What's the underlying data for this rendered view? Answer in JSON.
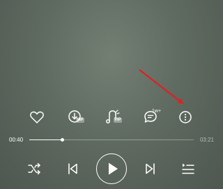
{
  "player": {
    "actions": {
      "like": {
        "icon": "heart-icon"
      },
      "download": {
        "icon": "download-icon",
        "badge": "VIP"
      },
      "ringtone": {
        "icon": "ringtone-icon",
        "badge": "VIP"
      },
      "comments": {
        "icon": "comment-icon",
        "count": "1w+"
      },
      "more": {
        "icon": "more-vertical-icon"
      }
    },
    "progress": {
      "current_time": "00:40",
      "total_time": "03:21",
      "fraction": 0.2
    },
    "controls": {
      "shuffle": {
        "icon": "shuffle-icon"
      },
      "previous": {
        "icon": "skip-previous-icon"
      },
      "play": {
        "icon": "play-icon"
      },
      "next": {
        "icon": "skip-next-icon"
      },
      "playlist": {
        "icon": "playlist-icon"
      }
    }
  },
  "annotation": {
    "color": "#e02020"
  },
  "colors": {
    "background": "#5f6a60",
    "foreground": "#ffffff"
  }
}
